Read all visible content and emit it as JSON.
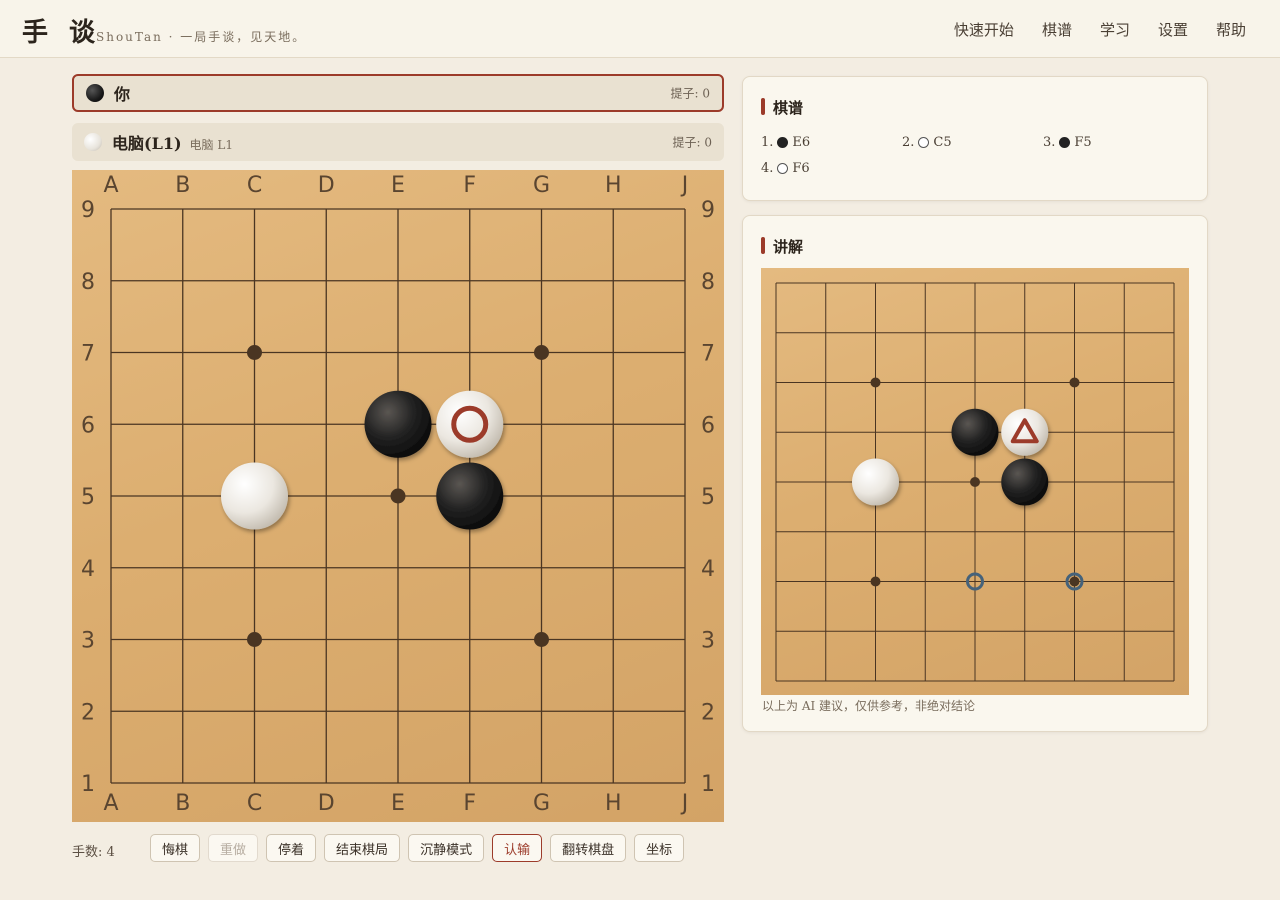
{
  "app": {
    "logo": "手 谈",
    "tagline": "ShouTan · 一局手谈，见天地。"
  },
  "nav": [
    "快速开始",
    "棋谱",
    "学习",
    "设置",
    "帮助"
  ],
  "players": {
    "black": {
      "name": "你",
      "subtitle": "",
      "captures": "提子: 0",
      "active": true
    },
    "white": {
      "name": "电脑(L1)",
      "subtitle": "电脑 L1",
      "captures": "提子: 0",
      "active": false
    }
  },
  "board": {
    "size": 9,
    "columns": [
      "A",
      "B",
      "C",
      "D",
      "E",
      "F",
      "G",
      "H",
      "J"
    ],
    "rows": [
      "9",
      "8",
      "7",
      "6",
      "5",
      "4",
      "3",
      "2",
      "1"
    ],
    "star_points": [
      "C7",
      "G7",
      "E5",
      "C3",
      "G3"
    ],
    "stones": [
      {
        "point": "E6",
        "color": "black"
      },
      {
        "point": "C5",
        "color": "white"
      },
      {
        "point": "F5",
        "color": "black"
      },
      {
        "point": "F6",
        "color": "white",
        "last": true
      }
    ],
    "last_marker_color": "#9c3b2a"
  },
  "bottom": {
    "move_count": "手数: 4",
    "buttons": [
      {
        "label": "悔棋",
        "state": "normal"
      },
      {
        "label": "重做",
        "state": "disabled"
      },
      {
        "label": "停着",
        "state": "normal"
      },
      {
        "label": "结束棋局",
        "state": "normal"
      },
      {
        "label": "沉静模式",
        "state": "normal"
      },
      {
        "label": "认输",
        "state": "danger"
      },
      {
        "label": "翻转棋盘",
        "state": "normal"
      },
      {
        "label": "坐标",
        "state": "normal"
      }
    ]
  },
  "kifu": {
    "title": "棋谱",
    "moves": [
      {
        "num": "1.",
        "color": "black",
        "point": "E6"
      },
      {
        "num": "2.",
        "color": "white",
        "point": "C5"
      },
      {
        "num": "3.",
        "color": "black",
        "point": "F5"
      },
      {
        "num": "4.",
        "color": "white",
        "point": "F6"
      }
    ]
  },
  "analysis": {
    "title": "讲解",
    "triangle_marker_point": "F6",
    "suggestions": [
      "E3",
      "G3"
    ],
    "suggestion_color": "#45627a",
    "note": "以上为 AI 建议，仅供参考，非绝对结论"
  }
}
